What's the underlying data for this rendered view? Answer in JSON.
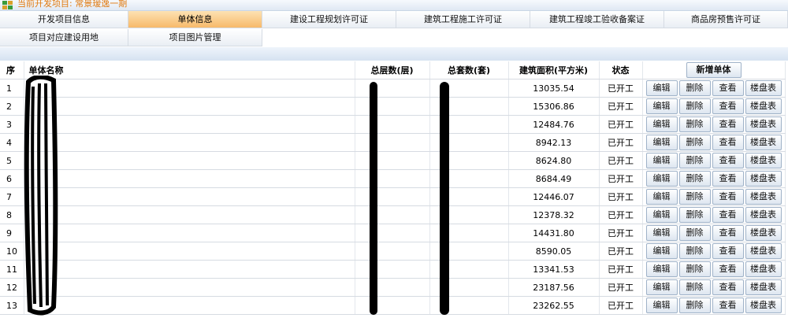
{
  "header": {
    "project_label": "当前开发项目: 常景瑷逸一期"
  },
  "tabs_row1": [
    {
      "label": "开发项目信息",
      "active": false
    },
    {
      "label": "单体信息",
      "active": true
    },
    {
      "label": "建设工程规划许可证",
      "active": false
    },
    {
      "label": "建筑工程施工许可证",
      "active": false
    },
    {
      "label": "建筑工程竣工验收备案证",
      "active": false
    },
    {
      "label": "商品房预售许可证",
      "active": false
    }
  ],
  "tabs_row2": [
    {
      "label": "项目对应建设用地"
    },
    {
      "label": "项目图片管理"
    }
  ],
  "table": {
    "headers": {
      "seq": "序",
      "name": "单体名称",
      "floors": "总层数(层)",
      "units": "总套数(套)",
      "area": "建筑面积(平方米)",
      "status": "状态",
      "add_button": "新增单体"
    },
    "actions": {
      "edit": "编辑",
      "delete": "删除",
      "view": "查看",
      "chart": "楼盘表"
    },
    "rows": [
      {
        "seq": "1",
        "area": "13035.54",
        "status": "已开工"
      },
      {
        "seq": "2",
        "area": "15306.86",
        "status": "已开工"
      },
      {
        "seq": "3",
        "area": "12484.76",
        "status": "已开工"
      },
      {
        "seq": "4",
        "area": "8942.13",
        "status": "已开工"
      },
      {
        "seq": "5",
        "area": "8624.80",
        "status": "已开工"
      },
      {
        "seq": "6",
        "area": "8684.49",
        "status": "已开工"
      },
      {
        "seq": "7",
        "area": "12446.07",
        "status": "已开工"
      },
      {
        "seq": "8",
        "area": "12378.32",
        "status": "已开工"
      },
      {
        "seq": "9",
        "area": "14431.80",
        "status": "已开工"
      },
      {
        "seq": "10",
        "area": "8590.05",
        "status": "已开工"
      },
      {
        "seq": "11",
        "area": "13341.53",
        "status": "已开工"
      },
      {
        "seq": "12",
        "area": "23187.56",
        "status": "已开工"
      },
      {
        "seq": "13",
        "area": "23262.55",
        "status": "已开工"
      }
    ]
  },
  "colors": {
    "active_tab": "#f7b96a",
    "header_bg": "#dfe8f3",
    "project_label": "#e07a10"
  }
}
